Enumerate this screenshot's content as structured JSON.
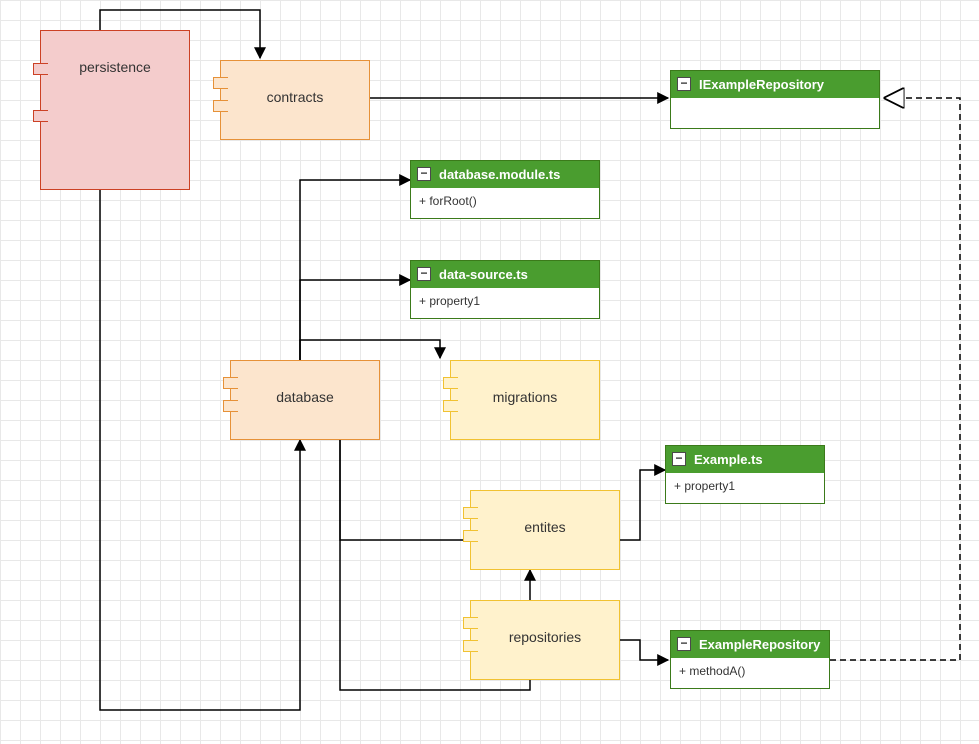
{
  "components": {
    "persistence": {
      "label": "persistence"
    },
    "contracts": {
      "label": "contracts"
    },
    "database": {
      "label": "database"
    },
    "migrations": {
      "label": "migrations"
    },
    "entities": {
      "label": "entites"
    },
    "repositories": {
      "label": "repositories"
    }
  },
  "classes": {
    "iExampleRepository": {
      "name": "IExampleRepository",
      "members": ""
    },
    "databaseModule": {
      "name": "database.module.ts",
      "members": "+ forRoot()"
    },
    "dataSource": {
      "name": "data-source.ts",
      "members": "+ property1"
    },
    "example": {
      "name": "Example.ts",
      "members": "+ property1"
    },
    "exampleRepository": {
      "name": "ExampleRepository",
      "members": "+ methodA()"
    }
  },
  "icons": {
    "collapse": "−"
  }
}
